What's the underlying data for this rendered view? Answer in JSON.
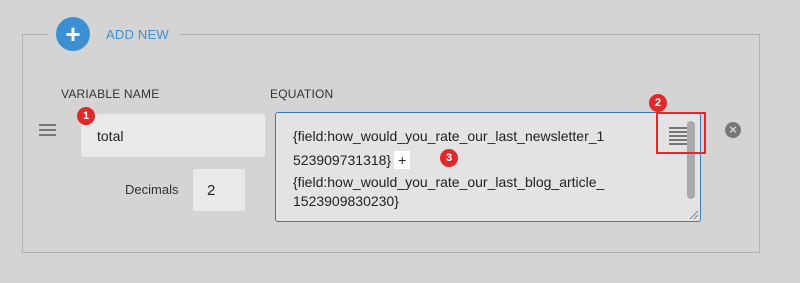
{
  "add_new": {
    "icon": "+",
    "label": "ADD NEW"
  },
  "headers": {
    "variable_name": "VARIABLE NAME",
    "equation": "EQUATION"
  },
  "row": {
    "variable_value": "total",
    "decimals_label": "Decimals",
    "decimals_value": "2",
    "equation_lines": [
      "{field:how_would_you_rate_our_last_newsletter_1",
      "523909731318}",
      "{field:how_would_you_rate_our_last_blog_article_",
      "1523909830230}"
    ],
    "operator": "+",
    "remove_icon": "×"
  },
  "badges": [
    "1",
    "2",
    "3"
  ],
  "colors": {
    "accent": "#3d8fd4",
    "callout": "#e02a2a",
    "background": "#d4d4d4"
  },
  "icons": [
    "plus-icon",
    "drag-handle-icon",
    "calculator-icon",
    "remove-circle-icon"
  ]
}
